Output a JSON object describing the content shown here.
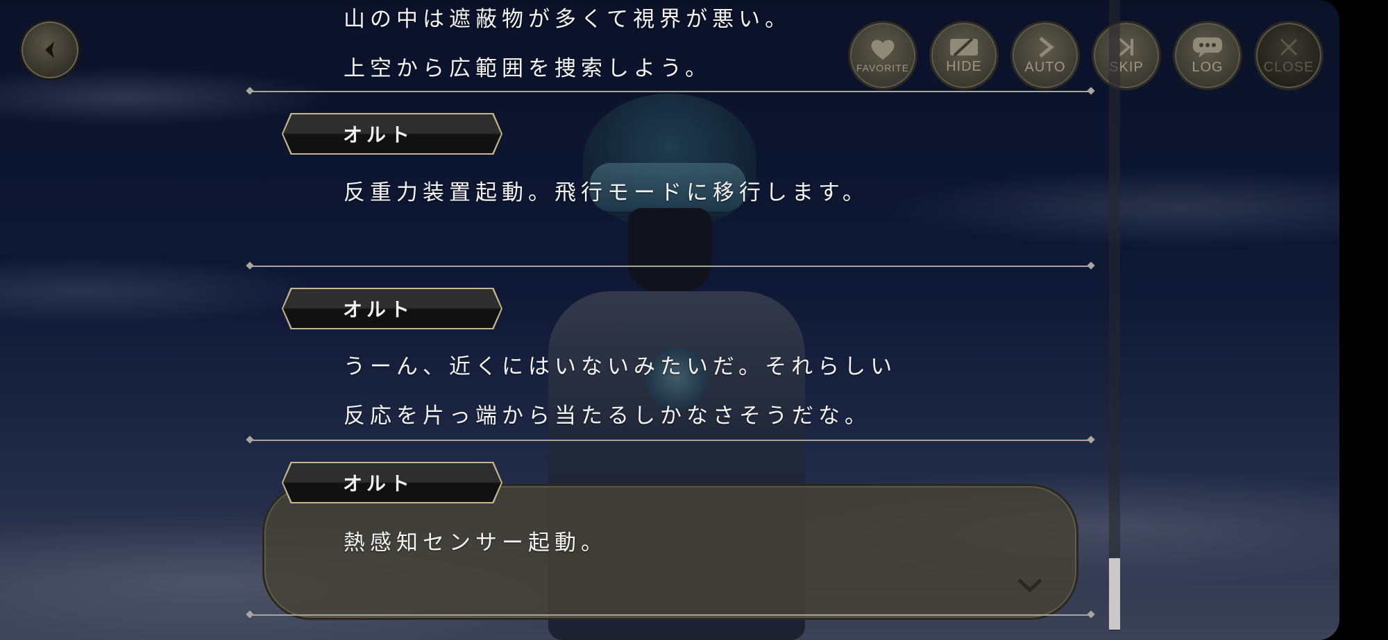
{
  "controls": {
    "favorite": "FAVORITE",
    "hide": "HIDE",
    "auto": "AUTO",
    "skip": "SKIP",
    "log": "LOG",
    "close": "CLOSE"
  },
  "icons": {
    "back": "back-arrow-icon",
    "favorite": "heart-icon",
    "hide": "hide-icon",
    "auto": "play-arrow-icon",
    "skip": "skip-icon",
    "log": "speech-bubble-icon",
    "close": "close-x-icon",
    "advance": "chevron-down-icon"
  },
  "log": {
    "entries": [
      {
        "speaker": "",
        "lines": [
          "山の中は遮蔽物が多くて視界が悪い。",
          "上空から広範囲を捜索しよう。"
        ]
      },
      {
        "speaker": "オルト",
        "lines": [
          "反重力装置起動。飛行モードに移行します。"
        ]
      },
      {
        "speaker": "オルト",
        "lines": [
          "うーん、近くにはいないみたいだ。それらしい",
          "反応を片っ端から当たるしかなさそうだな。"
        ]
      },
      {
        "speaker": "オルト",
        "lines": [
          "熱感知センサー起動。"
        ]
      }
    ]
  },
  "colors": {
    "name_plate_border": "#c7b78a",
    "separator": "#a9a79e",
    "button_face": "#5d5a4c",
    "text": "#f5f5f5"
  }
}
